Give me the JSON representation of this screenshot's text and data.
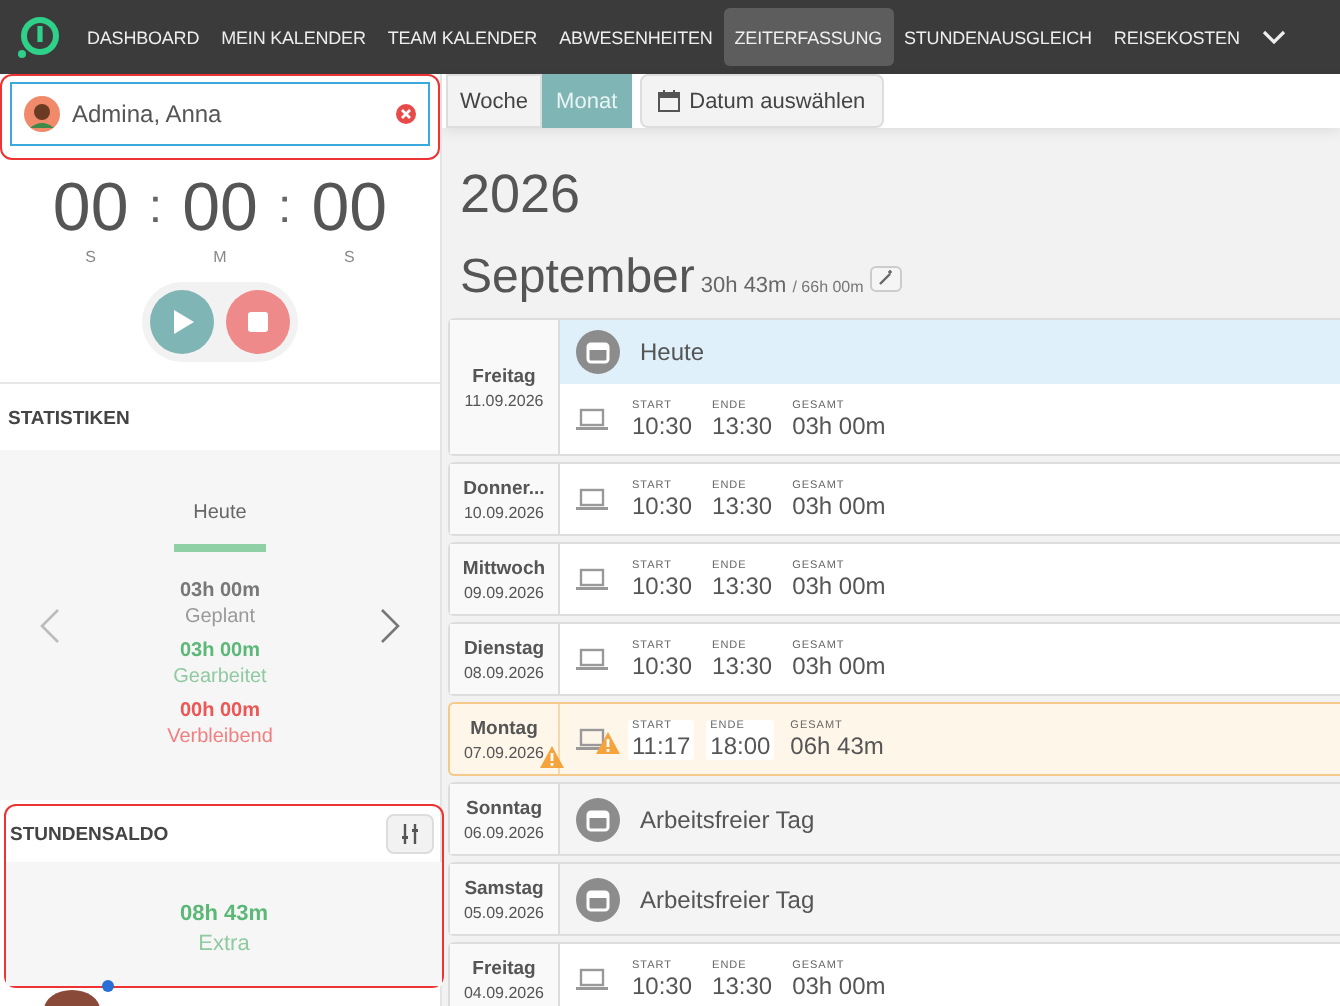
{
  "nav": {
    "items": [
      {
        "label": "DASHBOARD",
        "selected": false
      },
      {
        "label": "MEIN KALENDER",
        "selected": false
      },
      {
        "label": "TEAM KALENDER",
        "selected": false
      },
      {
        "label": "ABWESENHEITEN",
        "selected": false
      },
      {
        "label": "ZEITERFASSUNG",
        "selected": true
      },
      {
        "label": "STUNDENAUSGLEICH",
        "selected": false
      },
      {
        "label": "REISEKOSTEN",
        "selected": false
      }
    ]
  },
  "user_field": {
    "value": "Admina, Anna",
    "highlighted": true
  },
  "timer": {
    "hours": "00",
    "minutes": "00",
    "seconds": "00",
    "separator": ":",
    "hours_label": "S",
    "minutes_label": "M",
    "seconds_label": "S"
  },
  "statistics": {
    "title": "STATISTIKEN",
    "period": "Heute",
    "planned": "03h 00m",
    "planned_label": "Geplant",
    "worked": "03h 00m",
    "worked_label": "Gearbeitet",
    "remaining": "00h 00m",
    "remaining_label": "Verbleibend"
  },
  "balance": {
    "title": "STUNDENSALDO",
    "value": "08h 43m",
    "label": "Extra",
    "highlighted": true
  },
  "view_toggle": [
    {
      "label": "Woche",
      "selected": false
    },
    {
      "label": "Monat",
      "selected": true
    }
  ],
  "date_picker": {
    "label": "Datum auswählen"
  },
  "year": "2026",
  "month": {
    "name": "September",
    "worked": "30h 43m",
    "target": "/ 66h 00m"
  },
  "days": [
    {
      "kind": "today",
      "weekday": "Freitag",
      "date": "11.09.2026",
      "label": "Heute",
      "warning": false,
      "start_label": "START",
      "start": "10:30",
      "end_label": "ENDE",
      "end": "13:30",
      "total_label": "GESAMT",
      "total": "03h 00m"
    },
    {
      "kind": "work",
      "weekday": "Donner...",
      "date": "10.09.2026",
      "warning": false,
      "start_label": "START",
      "start": "10:30",
      "end_label": "ENDE",
      "end": "13:30",
      "total_label": "GESAMT",
      "total": "03h 00m"
    },
    {
      "kind": "work",
      "weekday": "Mittwoch",
      "date": "09.09.2026",
      "warning": false,
      "start_label": "START",
      "start": "10:30",
      "end_label": "ENDE",
      "end": "13:30",
      "total_label": "GESAMT",
      "total": "03h 00m"
    },
    {
      "kind": "work",
      "weekday": "Dienstag",
      "date": "08.09.2026",
      "warning": false,
      "start_label": "START",
      "start": "10:30",
      "end_label": "ENDE",
      "end": "13:30",
      "total_label": "GESAMT",
      "total": "03h 00m"
    },
    {
      "kind": "work",
      "weekday": "Montag",
      "date": "07.09.2026",
      "warning": true,
      "start_label": "START",
      "start": "11:17",
      "end_label": "ENDE",
      "end": "18:00",
      "total_label": "GESAMT",
      "total": "06h 43m"
    },
    {
      "kind": "free",
      "weekday": "Sonntag",
      "date": "06.09.2026",
      "label": "Arbeitsfreier Tag",
      "warning": false
    },
    {
      "kind": "free",
      "weekday": "Samstag",
      "date": "05.09.2026",
      "label": "Arbeitsfreier Tag",
      "warning": false
    },
    {
      "kind": "work",
      "weekday": "Freitag",
      "date": "04.09.2026",
      "warning": false,
      "start_label": "START",
      "start": "10:30",
      "end_label": "ENDE",
      "end": "13:30",
      "total_label": "GESAMT",
      "total": "03h 00m"
    }
  ]
}
